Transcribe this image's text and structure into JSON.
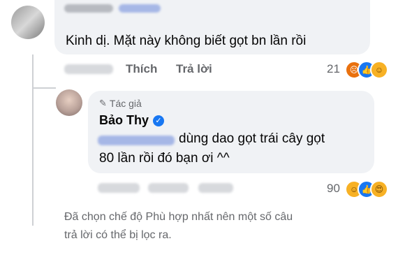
{
  "comment1": {
    "text": "Kinh dị. Mặt này không biết gọt bn lần rồi",
    "actions": {
      "like": "Thích",
      "reply": "Trả lời"
    },
    "reaction_count": "21"
  },
  "reply": {
    "author_badge": "Tác giả",
    "author_name": "Bảo Thy",
    "text_line1": "dùng dao gọt trái cây gọt",
    "text_line2": "80 lần rồi đó bạn ơi ^^",
    "reaction_count": "90"
  },
  "filter_note": {
    "line1": "Đã chọn chế độ Phù hợp nhất nên một số câu",
    "line2": "trả lời có thể bị lọc ra."
  },
  "colors": {
    "bubble": "#f0f2f5",
    "text": "#050505",
    "secondary": "#65676b",
    "verified": "#1877f2",
    "angry": "#e9710f",
    "like": "#1877f2",
    "haha": "#f7b125"
  }
}
